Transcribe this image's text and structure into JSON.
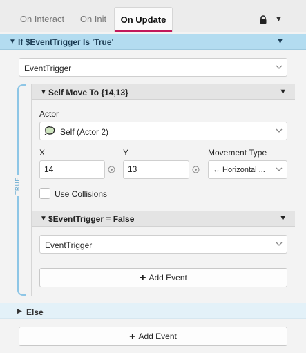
{
  "tabs": [
    {
      "label": "On Interact"
    },
    {
      "label": "On Init"
    },
    {
      "label": "On Update"
    }
  ],
  "if_block": {
    "title": "If $EventTrigger Is 'True'",
    "variable_select": "EventTrigger",
    "true_label": "TRUE"
  },
  "move_event": {
    "title": "Self Move To {14,13}",
    "actor_label": "Actor",
    "actor_value": "Self (Actor 2)",
    "x_label": "X",
    "x_value": "14",
    "y_label": "Y",
    "y_value": "13",
    "movement_label": "Movement Type",
    "movement_value": "↔ Horizontal ...",
    "collisions_label": "Use Collisions"
  },
  "set_event": {
    "title": "$EventTrigger = False",
    "variable_select": "EventTrigger"
  },
  "add_event_label": "Add Event",
  "else_block": {
    "title": "Else"
  },
  "colors": {
    "accent": "#c2185b",
    "if_header": "#b3dcf0",
    "else_header": "#e3f1f8"
  }
}
